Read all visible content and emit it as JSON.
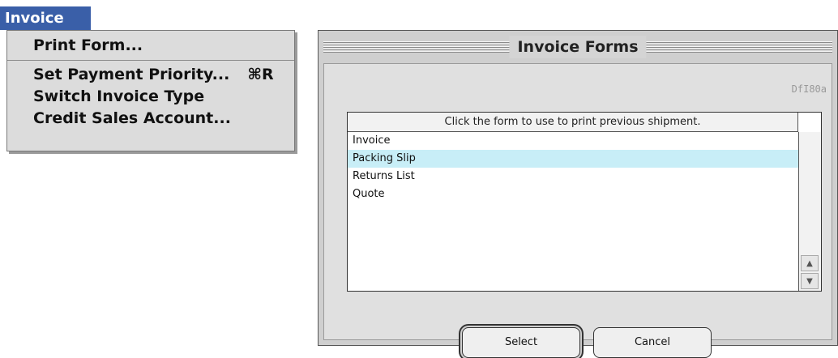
{
  "menu": {
    "title": "Invoice",
    "items": [
      {
        "label": "Print Form...",
        "shortcut": ""
      },
      {
        "label": "Set Payment Priority...",
        "shortcut": "⌘R"
      },
      {
        "label": "Switch Invoice Type",
        "shortcut": ""
      },
      {
        "label": "Credit Sales Account...",
        "shortcut": ""
      }
    ]
  },
  "dialog": {
    "title": "Invoice Forms",
    "form_code": "DfI80a",
    "list": {
      "header": "Click the form to use to print previous shipment.",
      "rows": [
        "Invoice",
        "Packing Slip",
        "Returns List",
        "Quote"
      ],
      "selected_index": 1
    },
    "buttons": {
      "select": "Select",
      "cancel": "Cancel"
    }
  },
  "colors": {
    "menu_title_bg": "#3a5fa8",
    "selected_row_bg": "#c8eef7",
    "dialog_bg": "#cfcfcf"
  }
}
